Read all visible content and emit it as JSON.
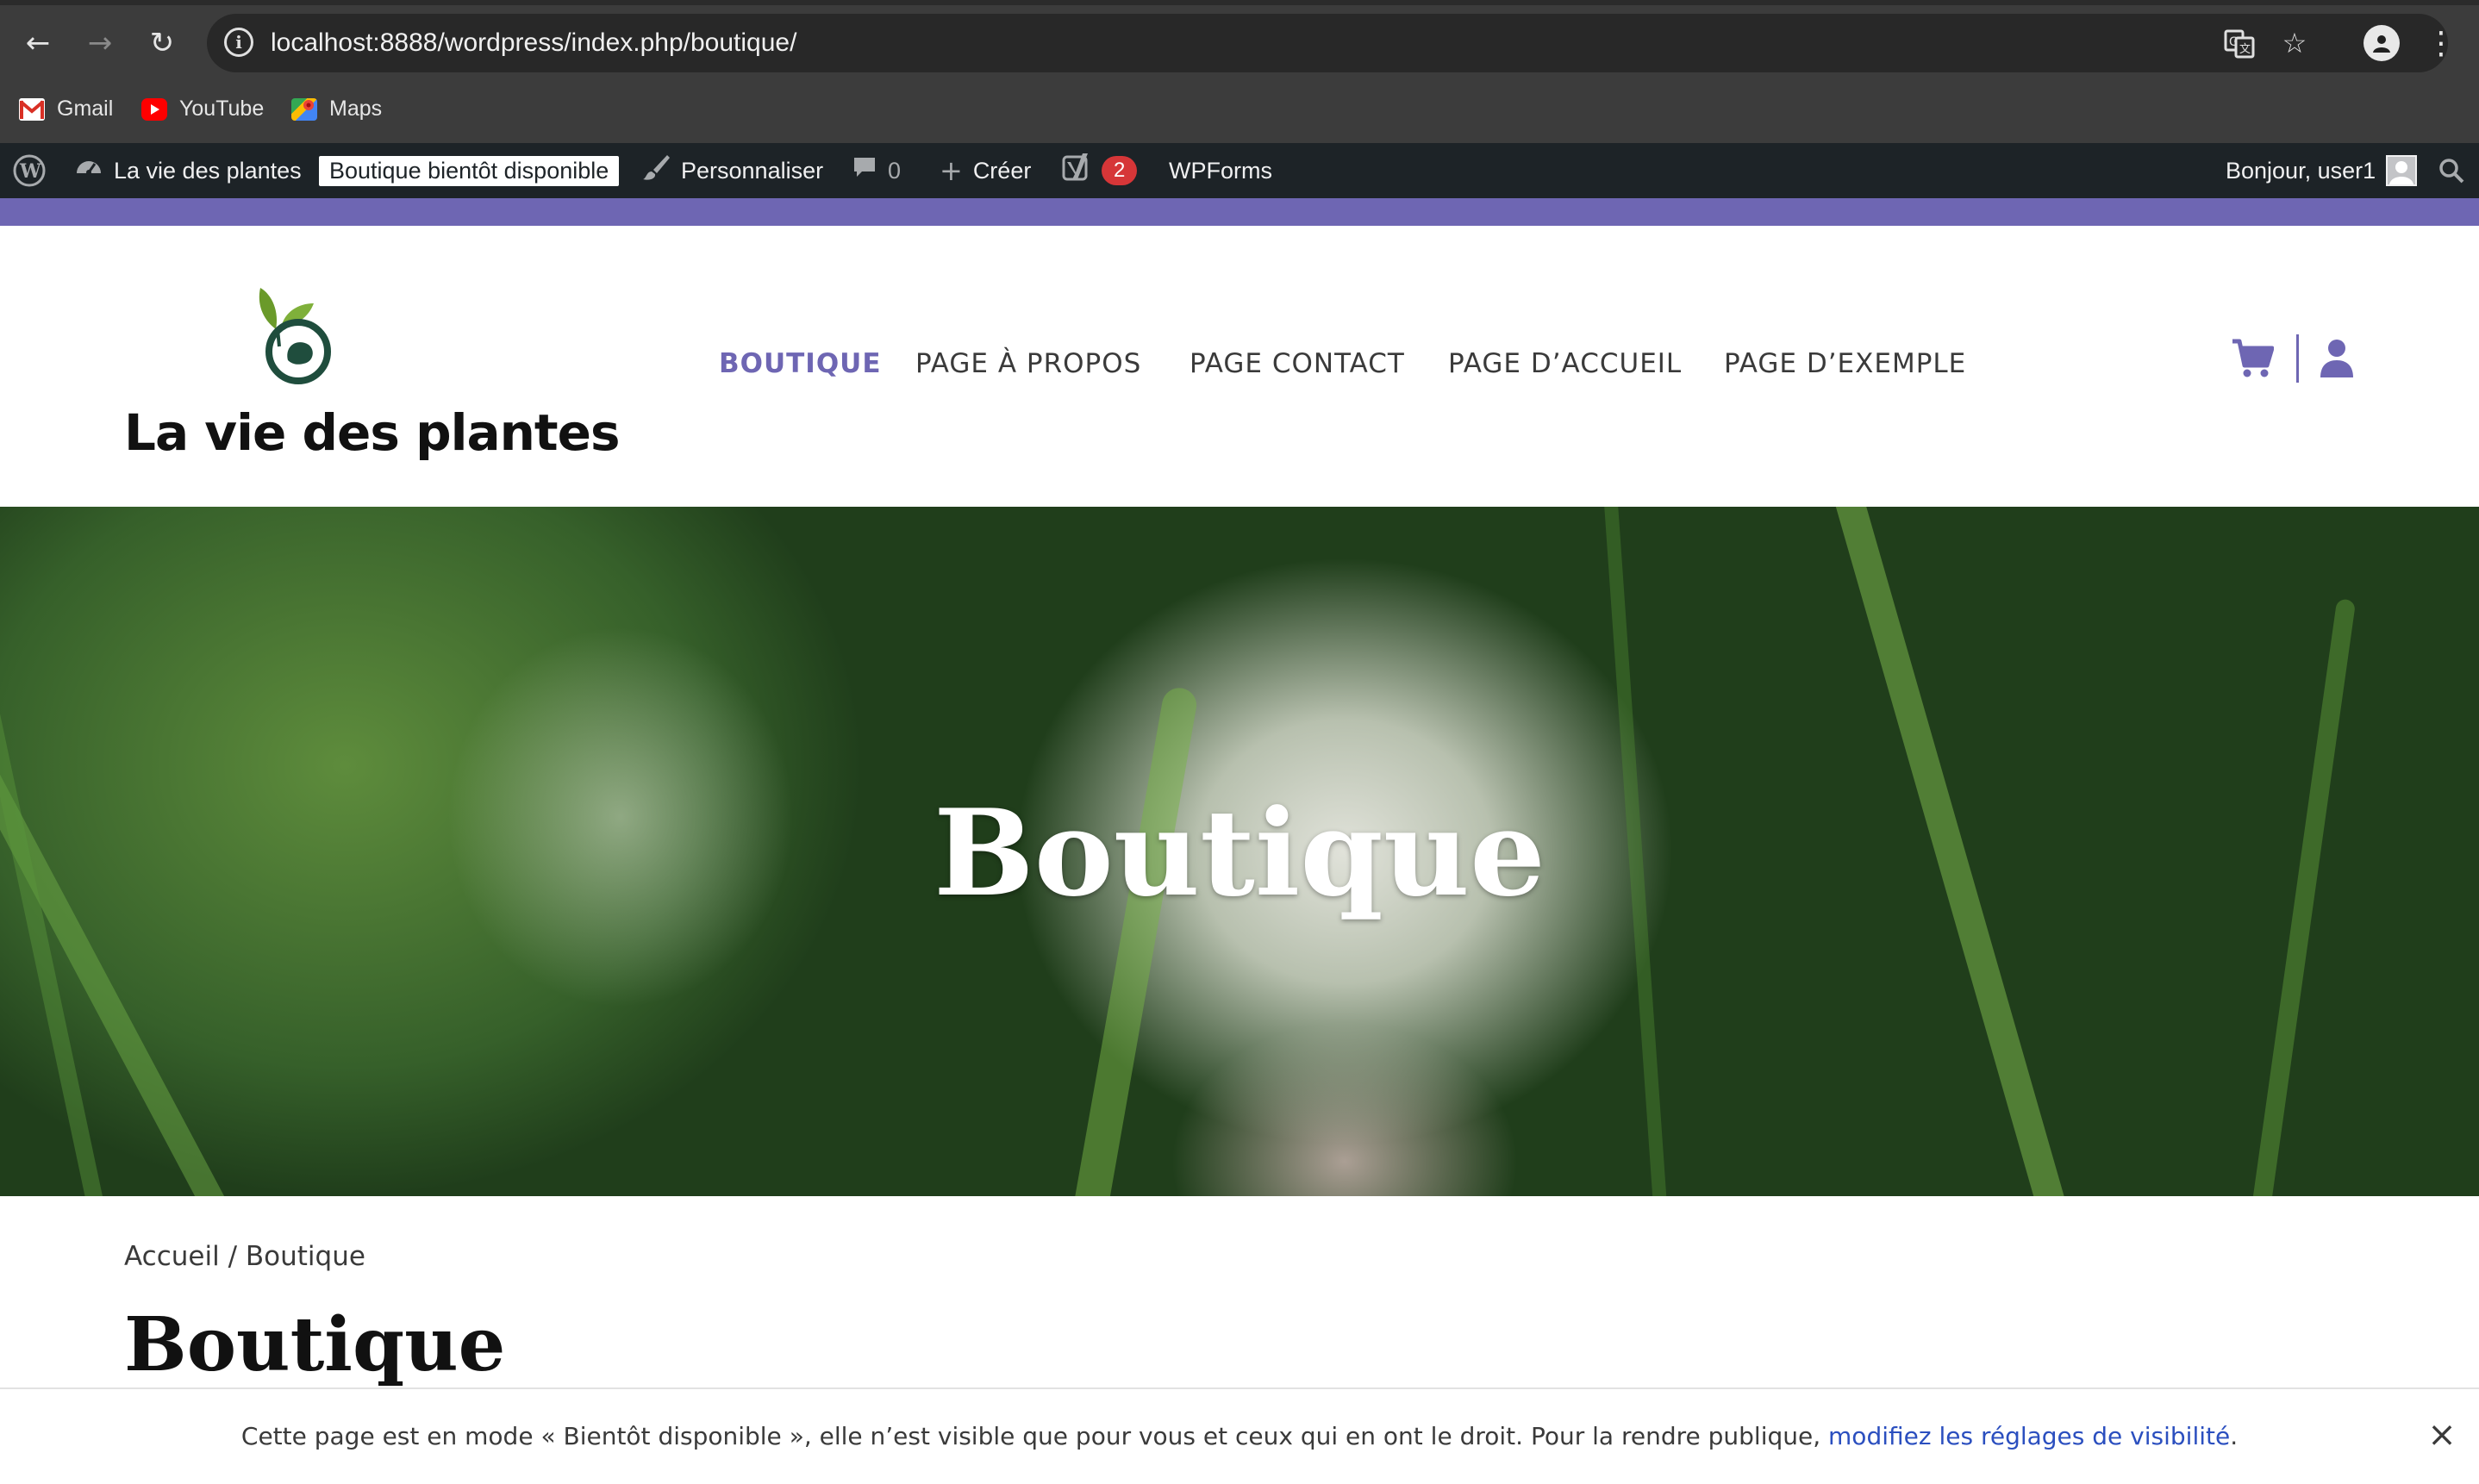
{
  "browser": {
    "url": "localhost:8888/wordpress/index.php/boutique/",
    "bookmarks": [
      {
        "label": "Gmail",
        "icon": "gmail-icon"
      },
      {
        "label": "YouTube",
        "icon": "youtube-icon"
      },
      {
        "label": "Maps",
        "icon": "maps-icon"
      }
    ]
  },
  "adminbar": {
    "site_name": "La vie des plantes",
    "coming_soon": "Boutique bientôt disponible",
    "customize": "Personnaliser",
    "comments_count": "0",
    "create": "Créer",
    "yoast_badge": "2",
    "wpforms": "WPForms",
    "greeting": "Bonjour, user1"
  },
  "site": {
    "title": "La vie des plantes",
    "menu": [
      "BOUTIQUE",
      "PAGE À PROPOS",
      "PAGE CONTACT",
      "PAGE D’ACCUEIL",
      "PAGE D’EXEMPLE"
    ],
    "accent_color": "#6e66b3"
  },
  "hero": {
    "title": "Boutique"
  },
  "breadcrumb": {
    "home": "Accueil",
    "separator": "/",
    "current": "Boutique"
  },
  "page": {
    "title": "Boutique"
  },
  "notice": {
    "text": "Cette page est en mode « Bientôt disponible », elle n’est visible que pour vous et ceux qui en ont le droit. Pour la rendre publique, ",
    "link": "modifiez les réglages de visibilité",
    "end": "."
  }
}
